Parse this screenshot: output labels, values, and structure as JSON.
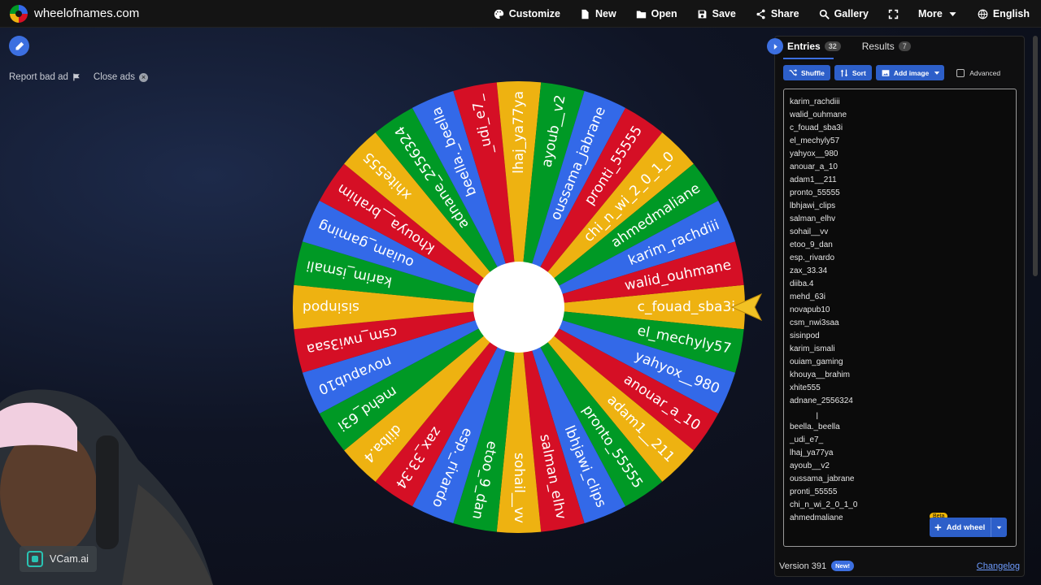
{
  "site": {
    "name": "wheelofnames.com"
  },
  "nav": [
    {
      "label": "Customize",
      "icon": "palette-icon"
    },
    {
      "label": "New",
      "icon": "file-icon"
    },
    {
      "label": "Open",
      "icon": "folder-icon"
    },
    {
      "label": "Save",
      "icon": "save-icon"
    },
    {
      "label": "Share",
      "icon": "share-icon"
    },
    {
      "label": "Gallery",
      "icon": "search-icon"
    },
    {
      "label": "",
      "icon": "fullscreen-icon"
    },
    {
      "label": "More",
      "icon": "chevron-down-icon"
    },
    {
      "label": "English",
      "icon": "globe-icon"
    }
  ],
  "ads": {
    "report": "Report bad ad",
    "close": "Close ads"
  },
  "webcam": {
    "label": "VCam.ai"
  },
  "panel": {
    "tabs": [
      {
        "label": "Entries",
        "count": "32"
      },
      {
        "label": "Results",
        "count": "7"
      }
    ],
    "tools": {
      "shuffle": "Shuffle",
      "sort": "Sort",
      "add_image": "Add image",
      "advanced": "Advanced"
    },
    "add_wheel": "Add wheel",
    "beta": "Beta",
    "version": "Version 391",
    "new_badge": "New!",
    "changelog": "Changelog"
  },
  "entries": [
    "karim_rachdiii",
    "walid_ouhmane",
    "c_fouad_sba3i",
    "el_mechyly57",
    "yahyox__980",
    "anouar_a_10",
    "adam1__211",
    "pronto_55555",
    "lbhjawi_clips",
    "salman_elhv",
    "sohail__vv",
    "etoo_9_dan",
    "esp._rivardo",
    "zax_33.34",
    "diiba.4",
    "mehd_63i",
    "novapub10",
    "csm_nwi3saa",
    "sisinpod",
    "karim_ismali",
    "ouiam_gaming",
    "khouya__brahim",
    "xhite555",
    "adnane_2556324",
    "",
    "beella._beella",
    "_udi_e7_",
    "lhaj_ya77ya",
    "ayoub__v2",
    "oussama_jabrane",
    "pronti_55555",
    "chi_n_wi_2_0_1_0",
    "ahmedmaliane"
  ],
  "wheel": {
    "colors": [
      "#eeb211",
      "#009925",
      "#3369e8",
      "#d50f25"
    ],
    "start_label": "c_fouad_sba3i"
  }
}
